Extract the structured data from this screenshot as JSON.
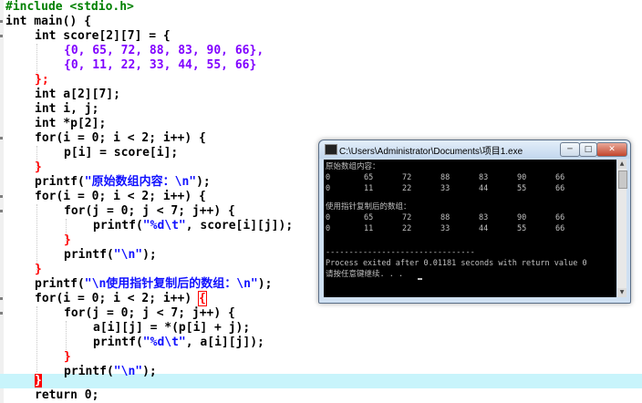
{
  "editor": {
    "lines": {
      "l1": "#include <stdio.h>",
      "l2a": "int",
      "l2b": " main() {",
      "l3a": "int",
      "l3b": " score[2][7] = {",
      "l4": "{0, 65, 72, 88, 83, 90, 66},",
      "l5": "{0, 11, 22, 33, 44, 55, 66}",
      "l6": "};",
      "l7a": "int",
      "l7b": " a[2][7];",
      "l8a": "int",
      "l8b": " i, j;",
      "l9a": "int",
      "l9b": " *p[2];",
      "l10a": "for",
      "l10b": "(i = 0; i < 2; i++) {",
      "l11": "p[i] = score[i];",
      "l12": "}",
      "l13a": "printf(",
      "l13b": "\"原始数组内容：\\n\"",
      "l13c": ");",
      "l14a": "for",
      "l14b": "(i = 0; i < 2; i++) {",
      "l15a": "for",
      "l15b": "(j = 0; j < 7; j++) {",
      "l16a": "printf(",
      "l16b": "\"%d\\t\"",
      "l16c": ", score[i][j]);",
      "l17": "}",
      "l18a": "printf(",
      "l18b": "\"\\n\"",
      "l18c": ");",
      "l19": "}",
      "l20a": "printf(",
      "l20b": "\"\\n使用指针复制后的数组：\\n\"",
      "l20c": ");",
      "l21a": "for",
      "l21b": "(i = 0; i < 2; i++) ",
      "l21c": "{",
      "l22a": "for",
      "l22b": "(j = 0; j < 7; j++) {",
      "l23": "a[i][j] = *(p[i] + j);",
      "l24a": "printf(",
      "l24b": "\"%d\\t\"",
      "l24c": ", a[i][j]);",
      "l25": "}",
      "l26a": "printf(",
      "l26b": "\"\\n\"",
      "l26c": ");",
      "l27": "}",
      "l28a": "return",
      "l28b": " 0;"
    }
  },
  "console": {
    "title": "C:\\Users\\Administrator\\Documents\\项目1.exe",
    "buttons": {
      "minimize": "─",
      "maximize": "□",
      "close": "✕"
    },
    "heading1": "原始数组内容：",
    "row1": [
      "0",
      "65",
      "72",
      "88",
      "83",
      "90",
      "66"
    ],
    "row2": [
      "0",
      "11",
      "22",
      "33",
      "44",
      "55",
      "66"
    ],
    "heading2": "使用指针复制后的数组：",
    "row3": [
      "0",
      "65",
      "72",
      "88",
      "83",
      "90",
      "66"
    ],
    "row4": [
      "0",
      "11",
      "22",
      "33",
      "44",
      "55",
      "66"
    ],
    "divider": "--------------------------------",
    "exit_msg": "Process exited after 0.01181 seconds with return value 0",
    "continue_msg": "请按任意键继续. . ."
  },
  "colors": {
    "keyword": "#000000",
    "preprocessor": "#008000",
    "number": "#8000ff",
    "string": "#1010ff",
    "symbol": "#ff0000",
    "current_line": "#c8f4fb",
    "console_bg": "#000000",
    "console_text": "#c0c0c0"
  }
}
